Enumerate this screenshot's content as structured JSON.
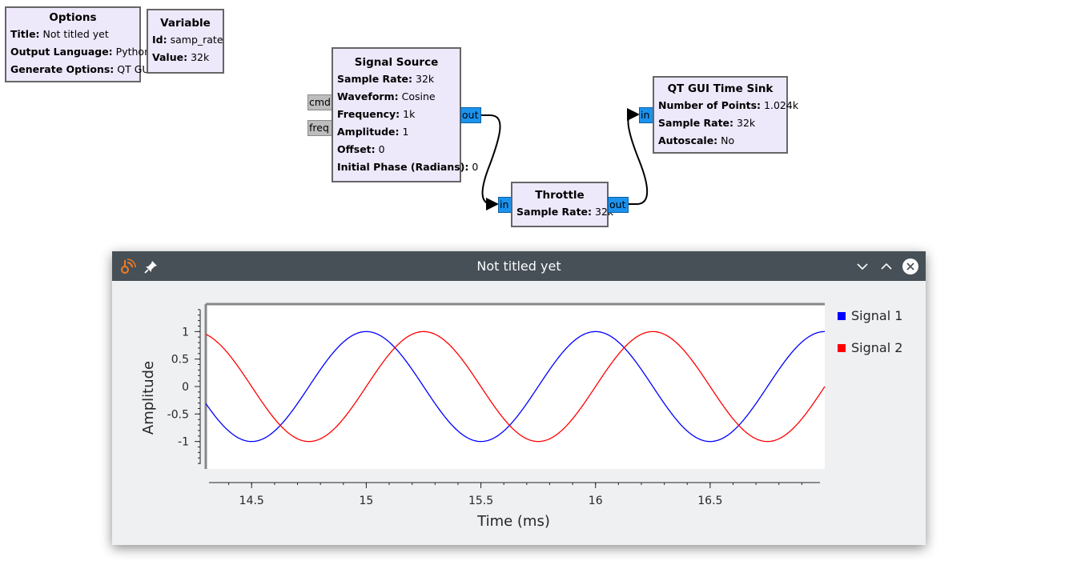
{
  "options_block": {
    "title": "Options",
    "rows": [
      {
        "key": "Title:",
        "value": "Not titled yet"
      },
      {
        "key": "Output Language:",
        "value": "Python"
      },
      {
        "key": "Generate Options:",
        "value": "QT GUI"
      }
    ]
  },
  "variable_block": {
    "title": "Variable",
    "rows": [
      {
        "key": "Id:",
        "value": "samp_rate"
      },
      {
        "key": "Value:",
        "value": "32k"
      }
    ]
  },
  "signal_source_block": {
    "title": "Signal Source",
    "rows": [
      {
        "key": "Sample Rate:",
        "value": "32k"
      },
      {
        "key": "Waveform:",
        "value": "Cosine"
      },
      {
        "key": "Frequency:",
        "value": "1k"
      },
      {
        "key": "Amplitude:",
        "value": "1"
      },
      {
        "key": "Offset:",
        "value": "0"
      },
      {
        "key": "Initial Phase (Radians):",
        "value": "0"
      }
    ],
    "ports": {
      "cmd": "cmd",
      "freq": "freq",
      "out": "out"
    }
  },
  "throttle_block": {
    "title": "Throttle",
    "rows": [
      {
        "key": "Sample Rate:",
        "value": "32k"
      }
    ],
    "ports": {
      "in": "in",
      "out": "out"
    }
  },
  "time_sink_block": {
    "title": "QT GUI Time Sink",
    "rows": [
      {
        "key": "Number of Points:",
        "value": "1.024k"
      },
      {
        "key": "Sample Rate:",
        "value": "32k"
      },
      {
        "key": "Autoscale:",
        "value": "No"
      }
    ],
    "ports": {
      "in": "in"
    }
  },
  "window": {
    "title": "Not titled yet",
    "icons": {
      "app": "gnuradio-icon",
      "pin": "pin-icon",
      "minimize": "chevron-down-icon",
      "maximize": "chevron-up-icon",
      "close": "close-icon"
    }
  },
  "colors": {
    "block_bg": "#eee8fb",
    "port_stream": "#1b93ee",
    "port_msg": "#bdbdbd",
    "titlebar": "#475057",
    "signal1": "#0000ff",
    "signal2": "#ff0000"
  },
  "chart_data": {
    "type": "line",
    "xlabel": "Time (ms)",
    "ylabel": "Amplitude",
    "xlim": [
      14.3,
      17.0
    ],
    "ylim": [
      -1.5,
      1.5
    ],
    "x_ticks": [
      14.5,
      15,
      15.5,
      16,
      16.5
    ],
    "x_tick_labels": [
      "14.5",
      "15",
      "15.5",
      "16",
      "16.5"
    ],
    "y_ticks": [
      1,
      0.5,
      0,
      -0.5,
      -1
    ],
    "y_tick_labels": [
      "1",
      "0.5",
      "0",
      "-0.5",
      "-1"
    ],
    "frequency_khz": 1,
    "grid": false,
    "legend_position": "right",
    "series": [
      {
        "name": "Signal 1",
        "color": "#0000ff",
        "amplitude": 1,
        "phase_ms": 0.0
      },
      {
        "name": "Signal 2",
        "color": "#ff0000",
        "amplitude": 1,
        "phase_ms": 0.25
      }
    ]
  }
}
